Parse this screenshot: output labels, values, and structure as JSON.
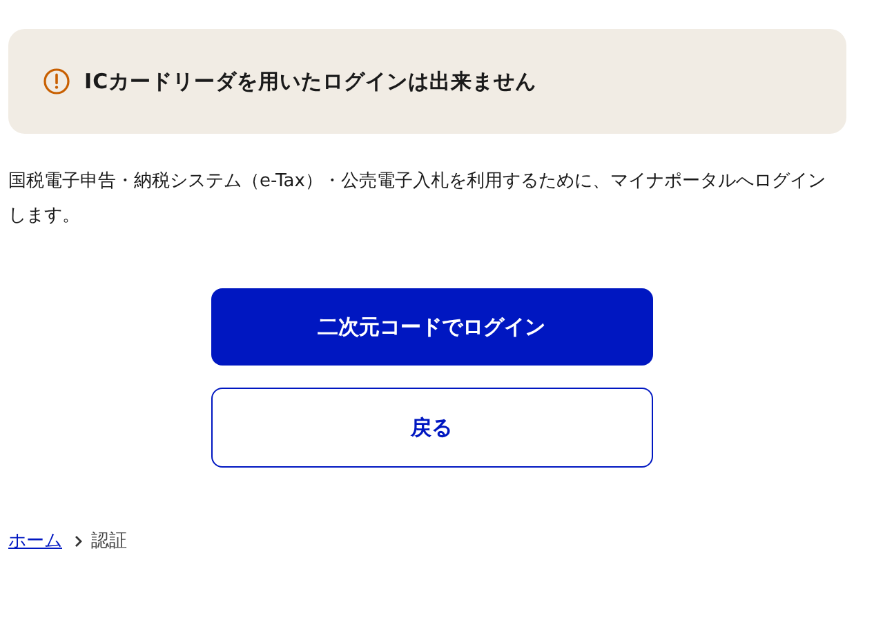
{
  "alert": {
    "kind": "warning",
    "message": "ICカードリーダを用いたログインは出来ません"
  },
  "description": "国税電子申告・納税システム（e-Tax）・公売電子入札を利用するために、マイナポータルへログインします。",
  "buttons": [
    {
      "label": "二次元コードでログイン",
      "kind": "primary"
    },
    {
      "label": "戻る",
      "kind": "secondary"
    }
  ],
  "breadcrumb": [
    {
      "label": "ホーム",
      "kind": "link"
    },
    {
      "label": "認証",
      "kind": "current"
    }
  ]
}
